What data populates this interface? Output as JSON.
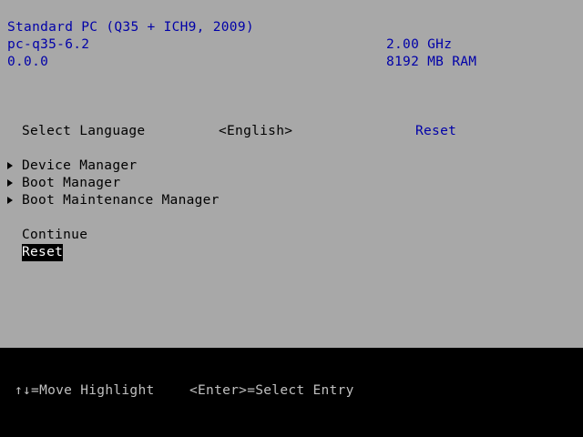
{
  "system_info": {
    "machine": "Standard PC (Q35 + ICH9, 2009)",
    "machine_type": "pc-q35-6.2",
    "version": "0.0.0",
    "cpu_speed": "2.00 GHz",
    "memory": "8192 MB RAM"
  },
  "language": {
    "label": "Select Language",
    "value": "<English>",
    "help_text": "Reset"
  },
  "menu": {
    "items": [
      {
        "label": "Device Manager",
        "icon": "triangle-right-icon"
      },
      {
        "label": "Boot Manager",
        "icon": "triangle-right-icon"
      },
      {
        "label": "Boot Maintenance Manager",
        "icon": "triangle-right-icon"
      }
    ]
  },
  "actions": {
    "continue": "Continue",
    "reset": "Reset"
  },
  "footer": {
    "move_hint": "↑↓=Move Highlight",
    "select_hint": "<Enter>=Select Entry"
  },
  "colors": {
    "panel_background": "#a8a8a8",
    "info_text": "#0000a8",
    "highlight_background": "#000000",
    "highlight_text": "#ffffff",
    "footer_text": "#c0c0c0"
  }
}
